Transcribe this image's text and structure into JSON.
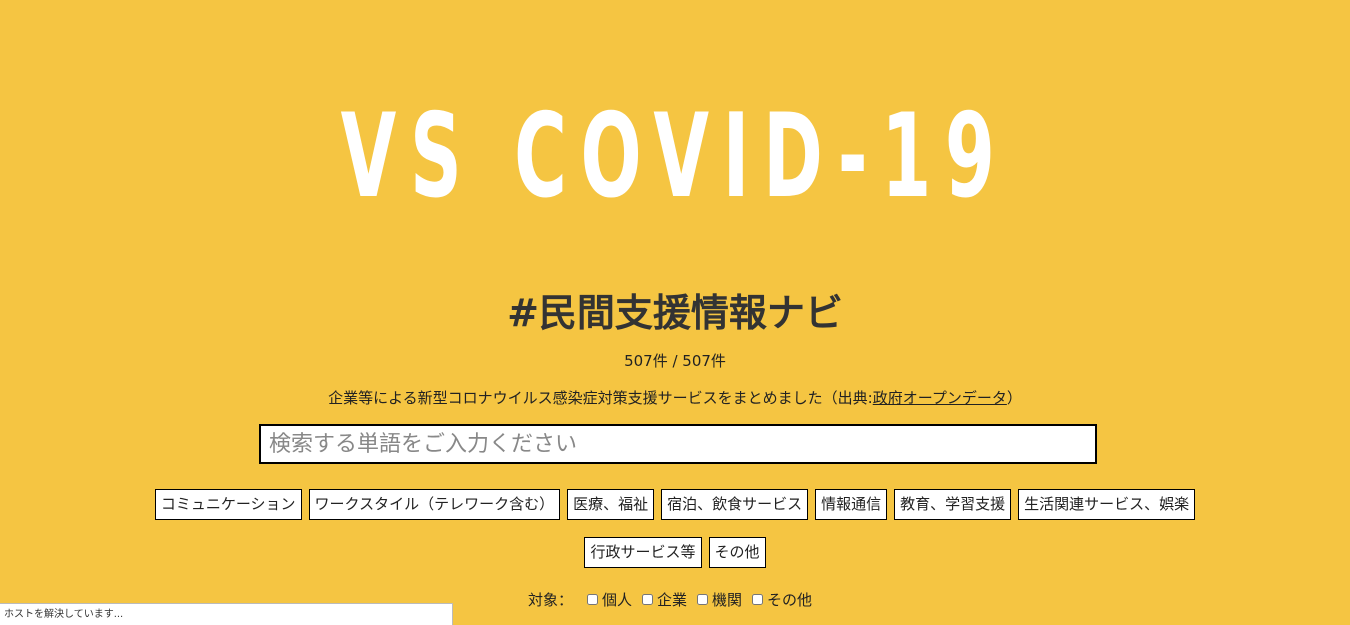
{
  "hero": {
    "title": "VS COVID-19"
  },
  "subtitle": "#民間支援情報ナビ",
  "count": "507件 / 507件",
  "description": {
    "prefix": "企業等による新型コロナウイルス感染症対策支援サービスをまとめました（出典:",
    "link": "政府オープンデータ",
    "suffix": "）"
  },
  "search": {
    "placeholder": "検索する単語をご入力ください",
    "value": ""
  },
  "categories_row1": [
    "コミュニケーション",
    "ワークスタイル（テレワーク含む）",
    "医療、福祉",
    "宿泊、飲食サービス",
    "情報通信",
    "教育、学習支援",
    "生活関連サービス、娯楽"
  ],
  "categories_row2": [
    "行政サービス等",
    "その他"
  ],
  "targets": {
    "label": "対象：",
    "options": [
      "個人",
      "企業",
      "機関",
      "その他"
    ]
  },
  "status_bar": "ホストを解決しています..."
}
